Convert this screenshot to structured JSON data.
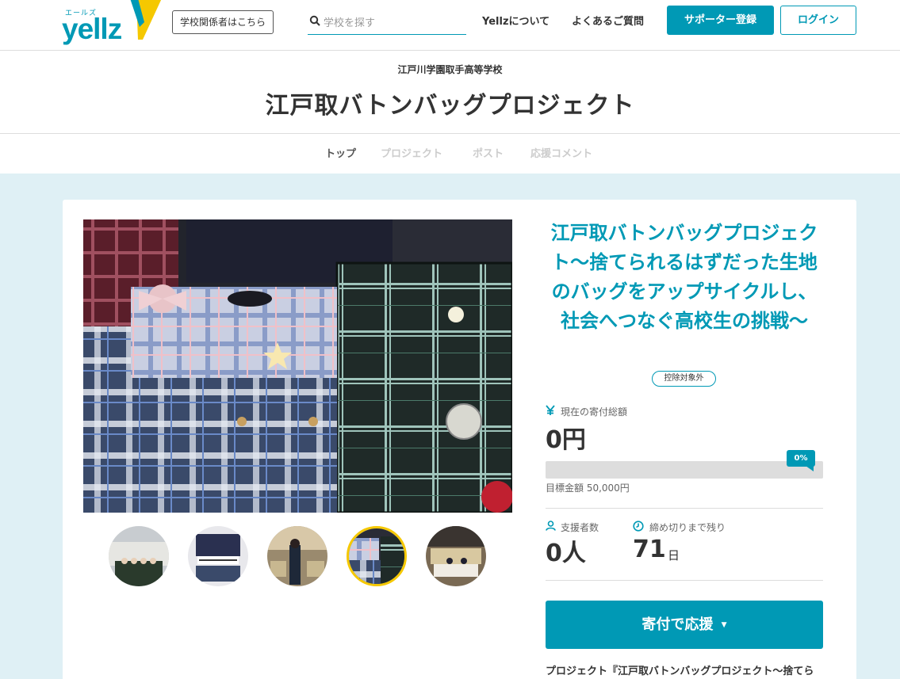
{
  "header": {
    "logo_ruby": "エールズ",
    "logo_text": "yellz",
    "school_link": "学校関係者はこちら",
    "search_placeholder": "学校を探す",
    "nav_about": "Yellzについて",
    "nav_faq": "よくあるご質問",
    "register_label": "サポーター登録",
    "login_label": "ログイン"
  },
  "page": {
    "school_name": "江戸川学園取手高等学校",
    "project_title": "江戸取バトンバッグプロジェクト"
  },
  "tabs": [
    {
      "label": "トップ",
      "active": true
    },
    {
      "label": "プロジェクト",
      "active": false
    },
    {
      "label": "ポスト",
      "active": false
    },
    {
      "label": "応援コメント",
      "active": false
    }
  ],
  "project": {
    "headline": "江戸取バトンバッグプロジェクト〜捨てられるはずだった生地のバッグをアップサイクルし、社会へつなぐ高校生の挑戦〜",
    "badge": "控除対象外",
    "donation_label": "現在の寄付総額",
    "donation_amount": "0円",
    "progress_percent": 0,
    "progress_label": "0%",
    "goal_text": "目標金額 50,000円",
    "supporters_label": "支援者数",
    "supporters_value": "0人",
    "deadline_label": "締め切りまで残り",
    "deadline_value": "71",
    "deadline_unit": "日",
    "donate_button": "寄付で応援",
    "description": "プロジェクト『江戸取バトンバッグプロジェクト〜捨てら"
  },
  "gallery": {
    "thumb_count": 5,
    "selected_index": 3
  },
  "colors": {
    "accent": "#0099b5",
    "logo_yellow": "#f5c800",
    "band_bg": "#dff0f5"
  }
}
